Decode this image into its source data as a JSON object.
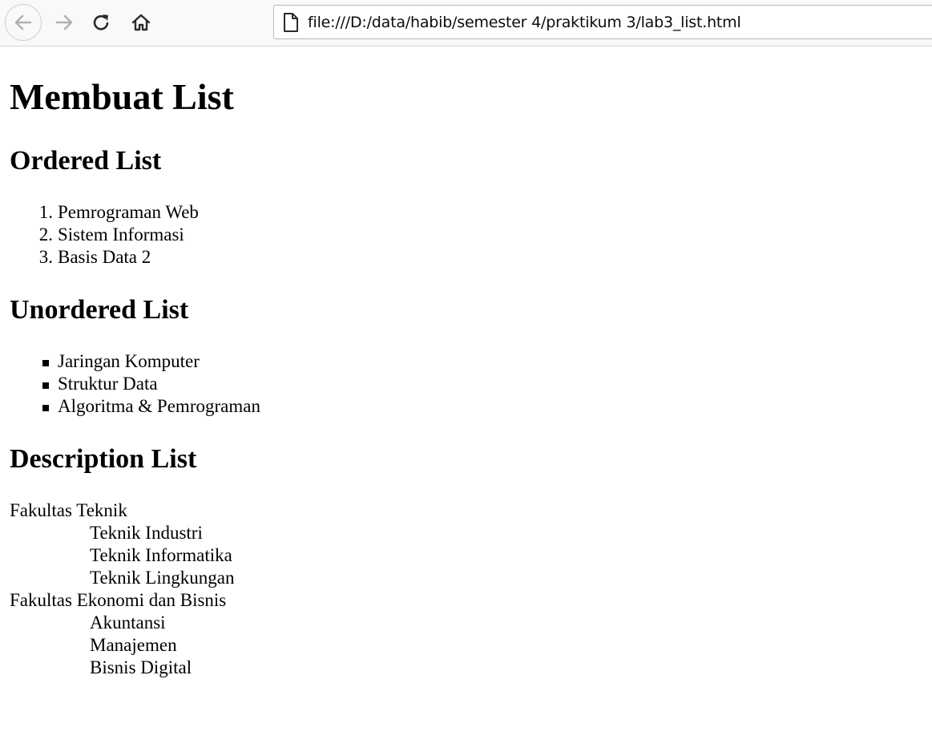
{
  "browser": {
    "url": "file:///D:/data/habib/semester 4/praktikum 3/lab3_list.html",
    "icons": {
      "back": "back-arrow-icon",
      "forward": "forward-arrow-icon",
      "reload": "reload-icon",
      "home": "home-icon",
      "page": "page-file-icon"
    }
  },
  "page": {
    "title": "Membuat List",
    "ordered": {
      "heading": "Ordered List",
      "items": [
        {
          "marker": "1.",
          "label": "Pemrograman Web"
        },
        {
          "marker": "2.",
          "label": "Sistem Informasi"
        },
        {
          "marker": "3.",
          "label": "Basis Data 2"
        }
      ]
    },
    "unordered": {
      "heading": "Unordered List",
      "items": [
        {
          "label": "Jaringan Komputer"
        },
        {
          "label": "Struktur Data"
        },
        {
          "label": "Algoritma & Pemrograman"
        }
      ]
    },
    "description": {
      "heading": "Description List",
      "groups": [
        {
          "term": "Fakultas Teknik",
          "definitions": [
            "Teknik Industri",
            "Teknik Informatika",
            "Teknik Lingkungan"
          ]
        },
        {
          "term": "Fakultas Ekonomi dan Bisnis",
          "definitions": [
            "Akuntansi",
            "Manajemen",
            "Bisnis Digital"
          ]
        }
      ]
    }
  }
}
